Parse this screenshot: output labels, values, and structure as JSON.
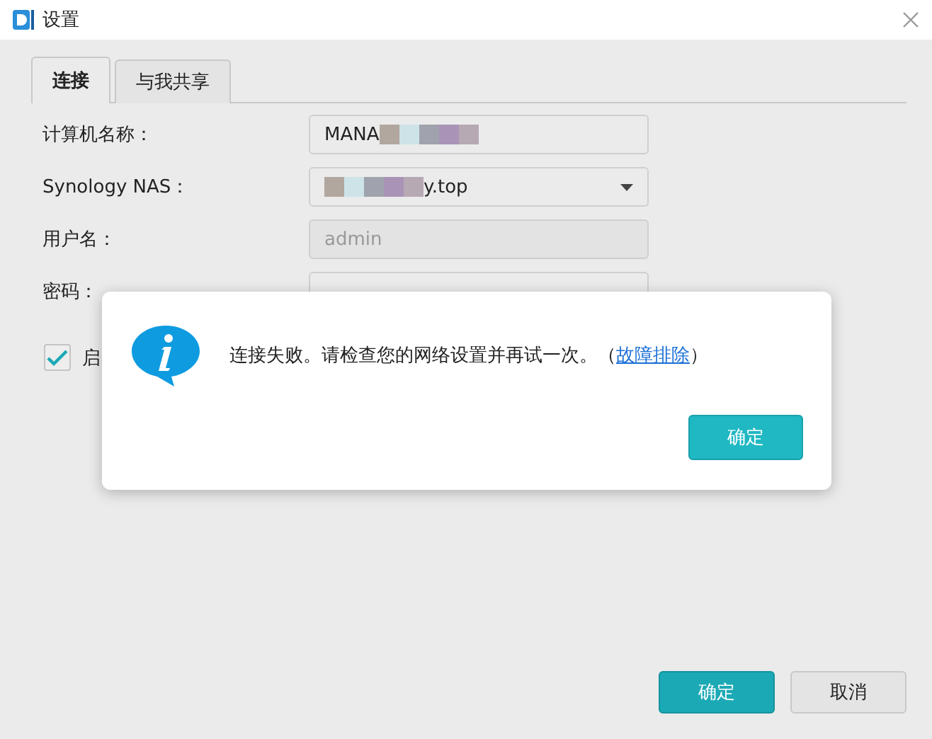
{
  "window": {
    "title": "设置"
  },
  "tabs": [
    {
      "label": "连接",
      "selected": true
    },
    {
      "label": "与我共享",
      "selected": false
    }
  ],
  "form": [
    {
      "kind": "text",
      "label": "计算机名称：",
      "value": "MANA",
      "redacted": true
    },
    {
      "kind": "dropdown",
      "label": "Synology NAS：",
      "value": "y.top",
      "redacted": true
    },
    {
      "kind": "disabled",
      "label": "用户名：",
      "value": "admin"
    },
    {
      "kind": "password",
      "label": "密码："
    }
  ],
  "checkbox": {
    "label": "启",
    "checked": true
  },
  "dialog": {
    "message": "连接失败。请检查您的网络设置并再试一次。（",
    "link": "故障排除",
    "message_end": "）",
    "button": "确定"
  },
  "buttons": [
    {
      "label": "确定",
      "kind": "primary"
    },
    {
      "label": "取消",
      "kind": "secondary"
    }
  ]
}
